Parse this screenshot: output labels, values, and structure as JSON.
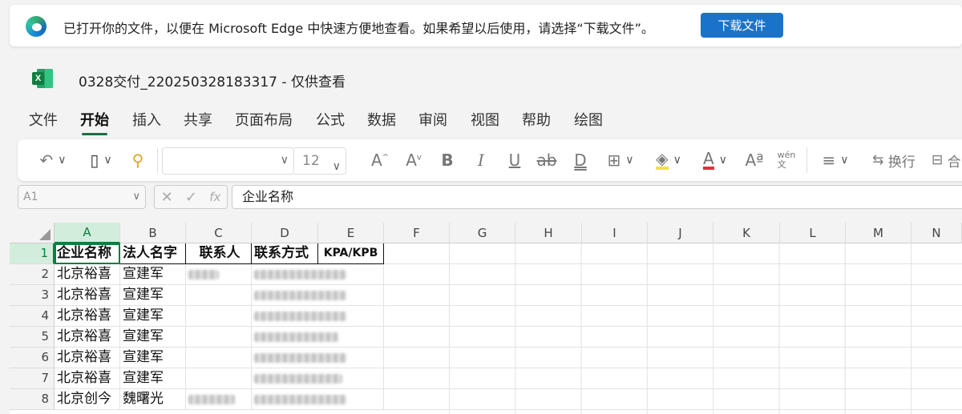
{
  "infobar": {
    "message": "已打开你的文件，以便在 Microsoft Edge 中快速方便地查看。如果希望以后使用，请选择“下载文件”。",
    "download_button": "下载文件"
  },
  "title_bar": {
    "document_title": "0328交付_220250328183317 - 仅供查看"
  },
  "menu_tabs": [
    "文件",
    "开始",
    "插入",
    "共享",
    "页面布局",
    "公式",
    "数据",
    "审阅",
    "视图",
    "帮助",
    "绘图"
  ],
  "active_tab": "开始",
  "ribbon": {
    "font_name": "",
    "font_size": "12",
    "wrap_text_label": "换行",
    "merge_label_partial": "合"
  },
  "formula_bar": {
    "name_box": "A1",
    "formula_value": "企业名称"
  },
  "grid": {
    "columns": [
      "A",
      "B",
      "C",
      "D",
      "E",
      "F",
      "G",
      "H",
      "I",
      "J",
      "K",
      "L",
      "M",
      "N"
    ],
    "row_numbers": [
      "1",
      "2",
      "3",
      "4",
      "5",
      "6",
      "7",
      "8"
    ],
    "header_row": [
      "企业名称",
      "法人名字",
      "联系人",
      "联系方式",
      "KPA/KPB"
    ],
    "rows": [
      {
        "a": "北京裕喜",
        "b": "宣建军"
      },
      {
        "a": "北京裕喜",
        "b": "宣建军"
      },
      {
        "a": "北京裕喜",
        "b": "宣建军"
      },
      {
        "a": "北京裕喜",
        "b": "宣建军"
      },
      {
        "a": "北京裕喜",
        "b": "宣建军"
      },
      {
        "a": "北京裕喜",
        "b": "宣建军"
      },
      {
        "a": "北京创今",
        "b": "魏曙光"
      }
    ]
  }
}
